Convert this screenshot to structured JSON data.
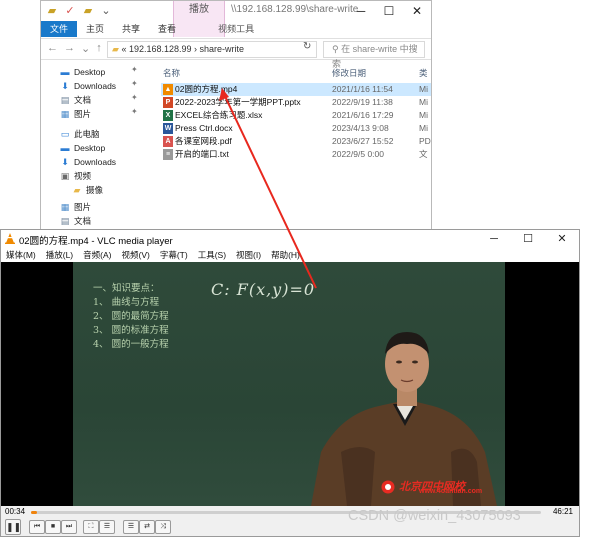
{
  "explorer": {
    "title_path": "\\\\192.168.128.99\\share-write",
    "play_ribbon_label": "播放",
    "window_controls": [
      "─",
      "☐",
      "✕"
    ],
    "ribbon_tabs": [
      "文件",
      "主页",
      "共享",
      "查看"
    ],
    "video_tools_label": "视频工具",
    "address": {
      "prefix": "«",
      "path": "192.168.128.99  ›  share-write",
      "chevron": "⌄",
      "refresh": "↻"
    },
    "search_placeholder": "在 share-write 中搜索",
    "nav_items": [
      {
        "label": "Desktop",
        "icon": "desktop-icon",
        "glyph": "▬",
        "color": "#2b7cd3",
        "pinned": true
      },
      {
        "label": "Downloads",
        "icon": "download-icon",
        "glyph": "⬇",
        "color": "#2b7cd3",
        "pinned": true
      },
      {
        "label": "文档",
        "icon": "document-icon",
        "glyph": "▤",
        "color": "#6a7f95",
        "pinned": true
      },
      {
        "label": "图片",
        "icon": "picture-icon",
        "glyph": "▦",
        "color": "#4a8ac9",
        "pinned": true
      },
      {
        "label": "此电脑",
        "icon": "computer-icon",
        "glyph": "▭",
        "color": "#2b7cd3",
        "pinned": false
      },
      {
        "label": "Desktop",
        "icon": "desktop-icon",
        "glyph": "▬",
        "color": "#2b7cd3",
        "pinned": false
      },
      {
        "label": "Downloads",
        "icon": "download-icon",
        "glyph": "⬇",
        "color": "#2b7cd3",
        "pinned": false
      },
      {
        "label": "视频",
        "icon": "video-folder-icon",
        "glyph": "▣",
        "color": "#6b6b6b",
        "pinned": false
      },
      {
        "label": "摄像",
        "icon": "folder-icon",
        "glyph": "▰",
        "color": "#e8b84a",
        "pinned": false
      },
      {
        "label": "图片",
        "icon": "picture-icon",
        "glyph": "▦",
        "color": "#4a8ac9",
        "pinned": false
      },
      {
        "label": "文档",
        "icon": "document-icon",
        "glyph": "▤",
        "color": "#6a7f95",
        "pinned": false
      }
    ],
    "columns": {
      "name": "名称",
      "date": "修改日期",
      "type": "类"
    },
    "files": [
      {
        "name": "02圆的方程.mp4",
        "date": "2021/1/16 11:54",
        "type": "Mi",
        "icon": "vlc-file-icon",
        "icon_color": "#f08a00",
        "glyph": "▲",
        "selected": true
      },
      {
        "name": "2022-2023学年第一学期PPT.pptx",
        "date": "2022/9/19 11:38",
        "type": "Mi",
        "icon": "pptx-file-icon",
        "icon_color": "#d24726",
        "glyph": "P",
        "selected": false
      },
      {
        "name": "EXCEL综合练习题.xlsx",
        "date": "2021/6/16 17:29",
        "type": "Mi",
        "icon": "xlsx-file-icon",
        "icon_color": "#217346",
        "glyph": "X",
        "selected": false
      },
      {
        "name": "Press Ctrl.docx",
        "date": "2023/4/13 9:08",
        "type": "Mi",
        "icon": "docx-file-icon",
        "icon_color": "#2b579a",
        "glyph": "W",
        "selected": false
      },
      {
        "name": "各课室网段.pdf",
        "date": "2023/6/27 15:52",
        "type": "PD",
        "icon": "pdf-file-icon",
        "icon_color": "#d9534f",
        "glyph": "A",
        "selected": false
      },
      {
        "name": "开启的端口.txt",
        "date": "2022/9/5 0:00",
        "type": "文",
        "icon": "txt-file-icon",
        "icon_color": "#9a9a9a",
        "glyph": "≡",
        "selected": false
      }
    ]
  },
  "vlc": {
    "title": "02圆的方程.mp4 - VLC media player",
    "window_controls": [
      "─",
      "☐",
      "✕"
    ],
    "menu": [
      "媒体(M)",
      "播放(L)",
      "音频(A)",
      "视频(V)",
      "字幕(T)",
      "工具(S)",
      "视图(I)",
      "帮助(H)"
    ],
    "board_lines": [
      "一、知识要点：",
      "1、 曲线与方程",
      "2、 圆的最简方程",
      "3、 圆的标准方程",
      "4、 圆的一般方程"
    ],
    "chalk_equation": "C:  F(x,y)=0",
    "logo_text": "北京四中网校",
    "logo_url": "www.4oantian.com",
    "elapsed": "00:34",
    "total": "46:21",
    "progress": 0.012,
    "controls": [
      {
        "name": "pause-button",
        "glyph": "❚❚"
      },
      {
        "name": "previous-button",
        "glyph": "⏮"
      },
      {
        "name": "stop-button",
        "glyph": "■"
      },
      {
        "name": "next-button",
        "glyph": "⏭"
      },
      {
        "name": "fullscreen-button",
        "glyph": "⛶"
      },
      {
        "name": "extended-settings-button",
        "glyph": "☰"
      },
      {
        "name": "playlist-button",
        "glyph": "☰"
      },
      {
        "name": "loop-button",
        "glyph": "⇄"
      },
      {
        "name": "shuffle-button",
        "glyph": "⤨"
      }
    ]
  },
  "watermark": "CSDN @weixin_43075093",
  "annotation_color": "#e8281e"
}
